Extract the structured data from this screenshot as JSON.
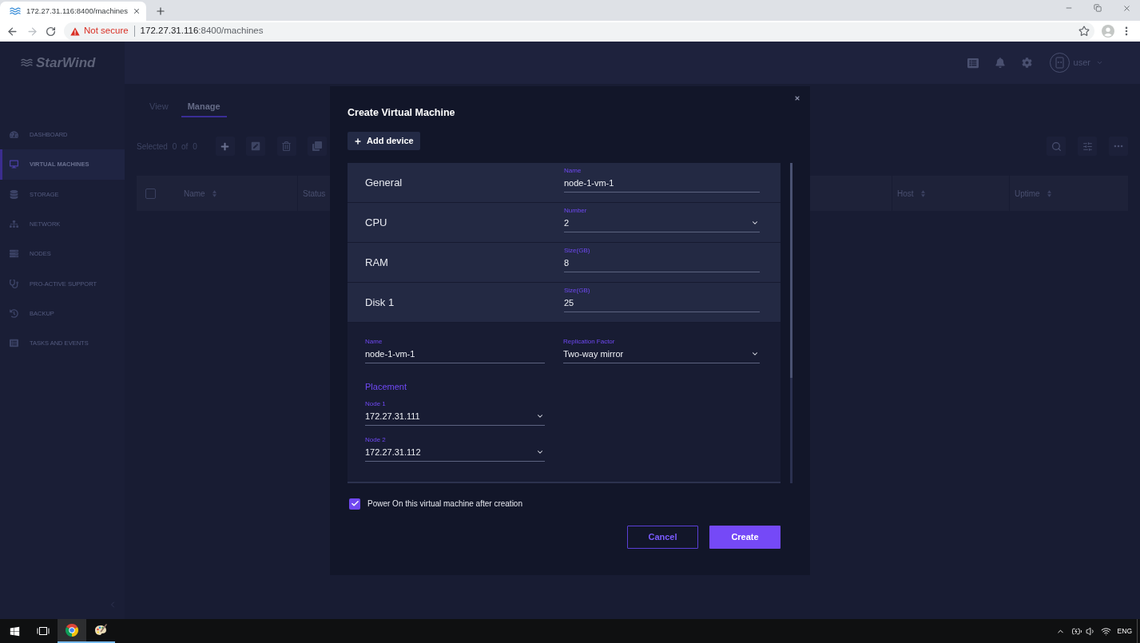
{
  "browser": {
    "tab_title": "172.27.31.116:8400/machines",
    "security_label": "Not secure",
    "url": {
      "host": "172.27.31.116",
      "rest": ":8400/machines"
    }
  },
  "app": {
    "logo": "StarWind",
    "user": "user",
    "sidebar": {
      "items": [
        {
          "label": "DASHBOARD",
          "selected": false
        },
        {
          "label": "VIRTUAL MACHINES",
          "selected": true
        },
        {
          "label": "STORAGE",
          "selected": false
        },
        {
          "label": "NETWORK",
          "selected": false
        },
        {
          "label": "NODES",
          "selected": false
        },
        {
          "label": "PRO-ACTIVE SUPPORT",
          "selected": false
        },
        {
          "label": "BACKUP",
          "selected": false
        },
        {
          "label": "TASKS AND EVENTS",
          "selected": false
        }
      ]
    },
    "tabs": [
      {
        "label": "View",
        "selected": false
      },
      {
        "label": "Manage",
        "selected": true
      }
    ],
    "selection_status": "Selected 0 of 0",
    "table": {
      "select_all": {
        "checked": false
      },
      "columns": [
        {
          "label": "Name",
          "sortable": true
        },
        {
          "label": "Status",
          "sortable": false
        },
        {
          "label": "Host",
          "sortable": true
        },
        {
          "label": "Uptime",
          "sortable": true
        }
      ]
    }
  },
  "dialog": {
    "title": "Create Virtual Machine",
    "add_device": "Add device",
    "devices": [
      {
        "name": "General",
        "field": {
          "label": "Name",
          "value": "node-1-vm-1",
          "kind": "text"
        }
      },
      {
        "name": "CPU",
        "field": {
          "label": "Number",
          "value": "2",
          "kind": "select"
        }
      },
      {
        "name": "RAM",
        "field": {
          "label": "Size(GB)",
          "value": "8",
          "kind": "text"
        }
      },
      {
        "name": "Disk 1",
        "field": {
          "label": "Size(GB)",
          "value": "25",
          "kind": "text"
        },
        "details": {
          "fields": [
            {
              "label": "Name",
              "value": "node-1-vm-1",
              "kind": "text"
            },
            {
              "label": "Replication Factor",
              "value": "Two-way mirror",
              "kind": "select"
            }
          ],
          "placement": {
            "title": "Placement",
            "nodes": [
              {
                "label": "Node 1",
                "value": "172.27.31.111",
                "kind": "select"
              },
              {
                "label": "Node 2",
                "value": "172.27.31.112",
                "kind": "select"
              }
            ]
          }
        }
      }
    ],
    "power_on": {
      "label": "Power On this virtual machine after creation",
      "checked": true
    },
    "buttons": [
      {
        "label": "Cancel",
        "kind": "secondary"
      },
      {
        "label": "Create",
        "kind": "primary"
      }
    ]
  },
  "taskbar": {
    "apps": [
      {
        "selected": true
      },
      {
        "selected": false
      }
    ],
    "language": "ENG"
  }
}
